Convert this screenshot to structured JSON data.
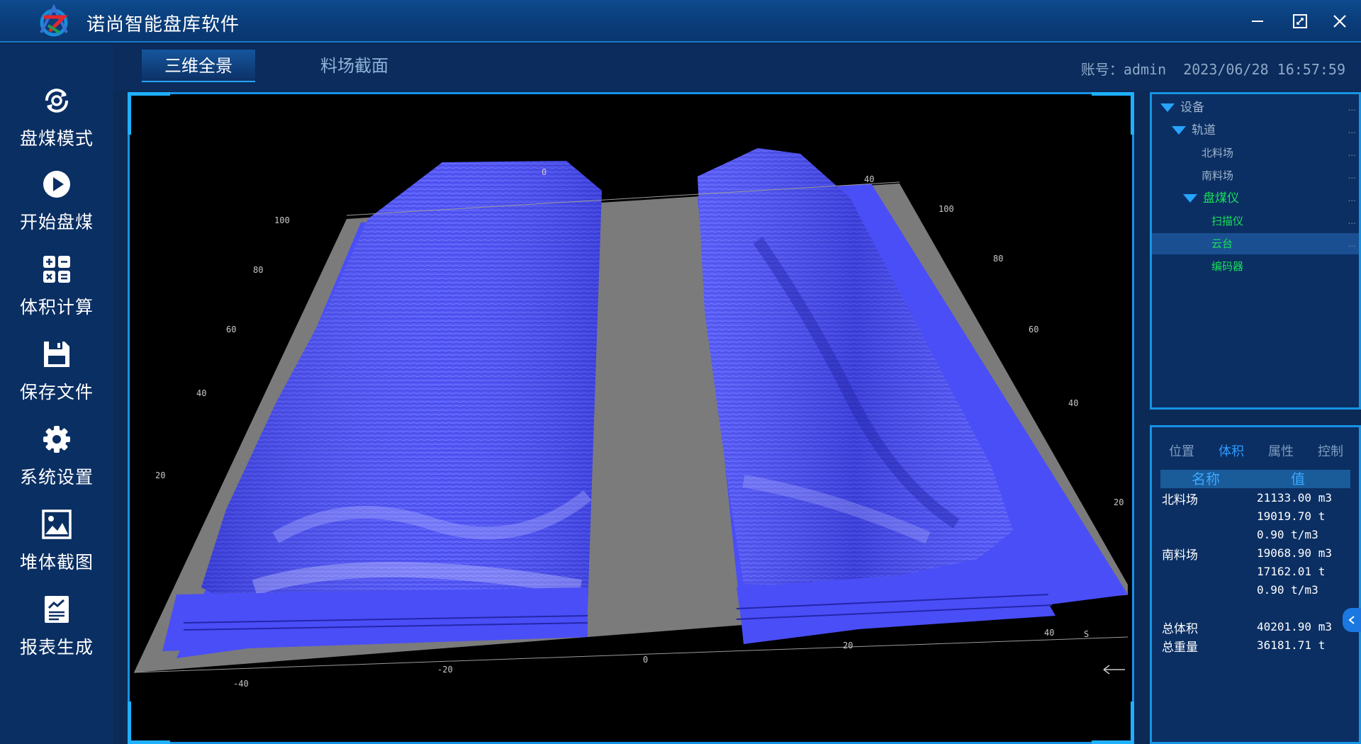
{
  "window": {
    "title": "诺尚智能盘库软件",
    "minimize_icon": "minimize-icon",
    "maximize_icon": "restore-icon",
    "close_icon": "close-icon"
  },
  "sidebar": {
    "items": [
      {
        "label": "盘煤模式",
        "icon": "mode-icon"
      },
      {
        "label": "开始盘煤",
        "icon": "play-icon"
      },
      {
        "label": "体积计算",
        "icon": "calculator-icon"
      },
      {
        "label": "保存文件",
        "icon": "save-icon"
      },
      {
        "label": "系统设置",
        "icon": "gear-icon"
      },
      {
        "label": "堆体截图",
        "icon": "image-icon"
      },
      {
        "label": "报表生成",
        "icon": "report-icon"
      }
    ]
  },
  "tabs": [
    {
      "label": "三维全景",
      "active": true
    },
    {
      "label": "料场截面",
      "active": false
    }
  ],
  "user": {
    "account_label": "账号：",
    "account": "admin",
    "datetime": "2023/06/28 16:57:59"
  },
  "viewport": {
    "axis_labels_back": [
      "0",
      "100",
      "80",
      "60",
      "40",
      "20"
    ],
    "axis_labels_right": [
      "40",
      "100",
      "80",
      "60",
      "40",
      "20"
    ],
    "axis_labels_front": [
      "-40",
      "-20",
      "0",
      "20",
      "40",
      "S"
    ],
    "surface_color": "#4a4ef7",
    "ground_color": "#7b7b7b"
  },
  "tree": {
    "items": [
      {
        "label": "设备",
        "level": 0,
        "expanded": true,
        "color": "#9fb4cc",
        "more": "..."
      },
      {
        "label": "轨道",
        "level": 1,
        "expanded": true,
        "color": "#9fb4cc",
        "more": "..."
      },
      {
        "label": "北料场",
        "level": 2,
        "expanded": null,
        "color": "#9fb4cc",
        "more": "..."
      },
      {
        "label": "南料场",
        "level": 2,
        "expanded": null,
        "color": "#9fb4cc",
        "more": "..."
      },
      {
        "label": "盘煤仪",
        "level": 2,
        "expanded": true,
        "color": "#19e05a",
        "more": "..."
      },
      {
        "label": "扫描仪",
        "level": 3,
        "expanded": null,
        "color": "#19e05a",
        "more": "..."
      },
      {
        "label": "云台",
        "level": 3,
        "expanded": null,
        "color": "#19e05a",
        "more": "...",
        "selected": true
      },
      {
        "label": "编码器",
        "level": 3,
        "expanded": null,
        "color": "#19e05a",
        "more": ""
      }
    ]
  },
  "info": {
    "tabs": [
      {
        "label": "位置",
        "active": false
      },
      {
        "label": "体积",
        "active": true
      },
      {
        "label": "属性",
        "active": false
      },
      {
        "label": "控制",
        "active": false
      }
    ],
    "header": {
      "name": "名称",
      "value": "值"
    },
    "rows": [
      {
        "label": "北料场",
        "value": "21133.00 m3"
      },
      {
        "label": "",
        "value": "19019.70 t"
      },
      {
        "label": "",
        "value": "0.90 t/m3"
      },
      {
        "label": "南料场",
        "value": "19068.90 m3"
      },
      {
        "label": "",
        "value": "17162.01 t"
      },
      {
        "label": "",
        "value": "0.90 t/m3"
      },
      {
        "label": "总体积",
        "value": "40201.90 m3"
      },
      {
        "label": "总重量",
        "value": "36181.71 t"
      }
    ],
    "collapse_icon": "chevron-left-icon"
  },
  "colors": {
    "accent": "#1793e6",
    "background": "#0b2a55",
    "green_text": "#19e05a"
  }
}
